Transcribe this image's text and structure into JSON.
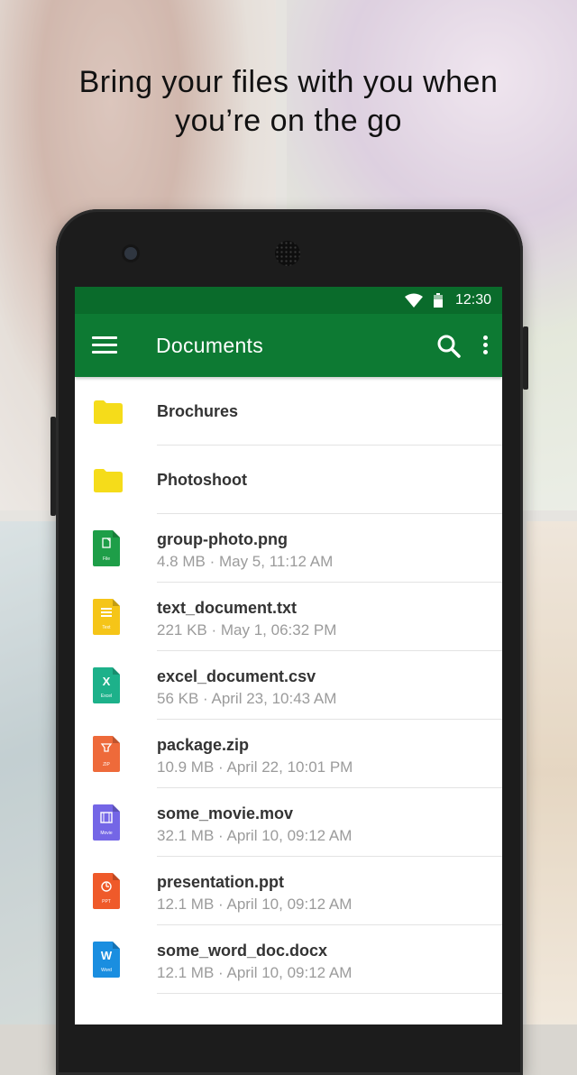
{
  "headline": {
    "line1": "Bring your files with you when",
    "line2": "you’re on the go"
  },
  "statusbar": {
    "time": "12:30",
    "icons": [
      "wifi-icon",
      "battery-icon"
    ]
  },
  "toolbar": {
    "title": "Documents",
    "icons": [
      "menu-icon",
      "search-icon",
      "more-vert-icon"
    ]
  },
  "colors": {
    "statusbar": "#0a6b2b",
    "toolbar": "#0d7a33",
    "folder": "#f5dc1a",
    "image_file": "#1e9e48",
    "text_file": "#f5c518",
    "excel_file": "#1db18a",
    "zip_file": "#ee6a3a",
    "movie_file": "#7466e6",
    "ppt_file": "#ef5a2a",
    "word_file": "#1a8ee0"
  },
  "items": [
    {
      "kind": "folder",
      "name": "Brochures"
    },
    {
      "kind": "folder",
      "name": "Photoshoot"
    },
    {
      "kind": "file",
      "name": "group-photo.png",
      "meta": "4.8 MB · May 5, 11:12 AM",
      "type_label": "File",
      "icon": "image-file-icon"
    },
    {
      "kind": "file",
      "name": "text_document.txt",
      "meta": "221 KB · May 1, 06:32 PM",
      "type_label": "Text",
      "icon": "text-file-icon"
    },
    {
      "kind": "file",
      "name": "excel_document.csv",
      "meta": "56 KB · April 23, 10:43 AM",
      "type_label": "Excel",
      "icon": "excel-file-icon"
    },
    {
      "kind": "file",
      "name": "package.zip",
      "meta": "10.9 MB · April 22, 10:01 PM",
      "type_label": "ZIP",
      "icon": "zip-file-icon"
    },
    {
      "kind": "file",
      "name": "some_movie.mov",
      "meta": "32.1 MB · April 10, 09:12 AM",
      "type_label": "Movie",
      "icon": "movie-file-icon"
    },
    {
      "kind": "file",
      "name": "presentation.ppt",
      "meta": "12.1 MB · April 10, 09:12 AM",
      "type_label": "PPT",
      "icon": "ppt-file-icon"
    },
    {
      "kind": "file",
      "name": "some_word_doc.docx",
      "meta": "12.1 MB · April 10, 09:12 AM",
      "type_label": "Word",
      "icon": "word-file-icon"
    }
  ]
}
